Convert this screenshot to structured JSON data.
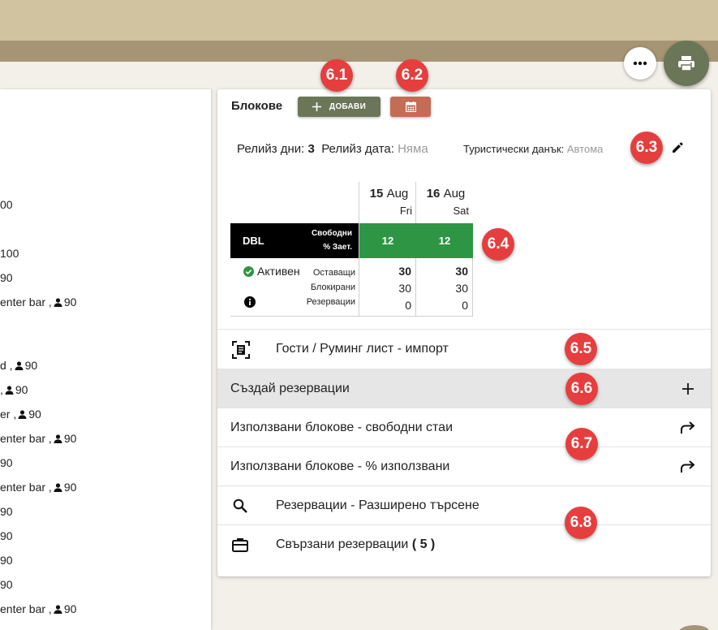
{
  "left_list": [
    {
      "text": "00",
      "icon": false
    },
    {
      "text": "100",
      "icon": false
    },
    {
      "text": "90",
      "icon": false
    },
    {
      "prefix": "enter bar ,",
      "text": "90",
      "icon": true
    },
    {
      "prefix": "d ,",
      "text": "90",
      "icon": true
    },
    {
      "prefix": ",",
      "text": "90",
      "icon": true
    },
    {
      "prefix": "er ,",
      "text": "90",
      "icon": true
    },
    {
      "prefix": "enter bar ,",
      "text": "90",
      "icon": true
    },
    {
      "text": "90",
      "icon": false
    },
    {
      "prefix": "enter bar ,",
      "text": "90",
      "icon": true
    },
    {
      "text": "90",
      "icon": false
    },
    {
      "text": "90",
      "icon": false
    },
    {
      "text": "90",
      "icon": false
    },
    {
      "text": "90",
      "icon": false
    },
    {
      "prefix": "enter bar ,",
      "text": "90",
      "icon": true
    }
  ],
  "blocks": {
    "title": "Блокове",
    "add_label": "ДОБАВИ",
    "release_days_label": "Релийз дни:",
    "release_days_value": "3",
    "release_date_label": "Релийз дата:",
    "release_date_value": "Няма",
    "tax_label": "Туристически данък:",
    "tax_value": "Автома"
  },
  "grid": {
    "dates": [
      {
        "day": "15",
        "month": "Aug",
        "weekday": "Fri"
      },
      {
        "day": "16",
        "month": "Aug",
        "weekday": "Sat"
      }
    ],
    "room_type": "DBL",
    "free_label": "Свободни",
    "occupancy_label": "% Зает.",
    "free_values": [
      "12",
      "12"
    ],
    "status": "Активен",
    "remaining_label": "Оставащи",
    "blocked_label": "Блокирани",
    "reservations_label": "Резервации",
    "remaining_values": [
      "30",
      "30"
    ],
    "blocked_values": [
      "30",
      "30"
    ],
    "reservations_values": [
      "0",
      "0"
    ]
  },
  "menu": {
    "guests_import": "Гости / Руминг лист - импорт",
    "create_reservations": "Създай резервации",
    "used_free_rooms": "Използвани блокове - свободни стаи",
    "used_percent": "Използвани блокове - % използвани",
    "advanced_search": "Резервации - Разширено търсене",
    "linked_reservations": "Свързани резервации",
    "linked_count": "( 5 )"
  },
  "badges": [
    "6.1",
    "6.2",
    "6.3",
    "6.4",
    "6.5",
    "6.6",
    "6.7",
    "6.8"
  ],
  "colors": {
    "header": "#d2c3a0",
    "subheader": "#a69575",
    "primary_olive": "#6b7558",
    "calendar_button": "#c46c55",
    "free_cell_green": "#2e9545",
    "badge_red": "#e63e3e",
    "active_selected_row": "#e6e6e6"
  }
}
